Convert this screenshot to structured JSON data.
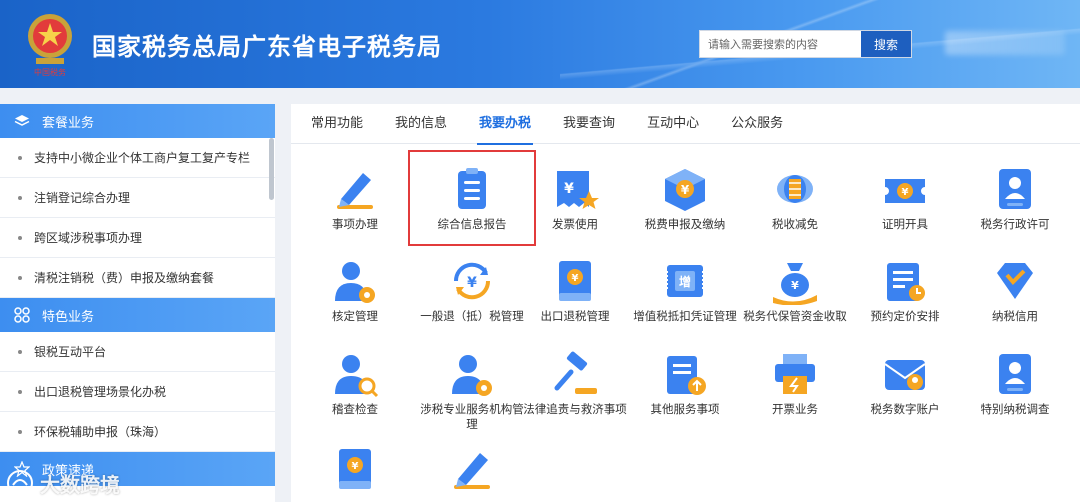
{
  "header": {
    "title": "国家税务总局广东省电子税务局",
    "emblem_text": "中国税务",
    "search": {
      "placeholder": "请输入需要搜索的内容",
      "button": "搜索"
    }
  },
  "sidebar": {
    "sections": [
      {
        "title": "套餐业务",
        "icon": "layers-icon",
        "items": [
          "支持中小微企业个体工商户复工复产专栏",
          "注销登记综合办理",
          "跨区域涉税事项办理",
          "清税注销税（费）申报及缴纳套餐"
        ]
      },
      {
        "title": "特色业务",
        "icon": "grid-icon",
        "items": [
          "银税互动平台",
          "出口退税管理场景化办税",
          "环保税辅助申报（珠海）"
        ]
      },
      {
        "title": "政策速递",
        "icon": "star-icon",
        "items": []
      }
    ]
  },
  "tabs": [
    "常用功能",
    "我的信息",
    "我要办税",
    "我要查询",
    "互动中心",
    "公众服务"
  ],
  "active_tab": "我要办税",
  "services": [
    {
      "label": "事项办理",
      "icon": "pen-icon"
    },
    {
      "label": "综合信息报告",
      "icon": "clipboard-icon"
    },
    {
      "label": "发票使用",
      "icon": "invoice-icon"
    },
    {
      "label": "税费申报及缴纳",
      "icon": "cube-yuan-icon"
    },
    {
      "label": "税收减免",
      "icon": "coins-icon"
    },
    {
      "label": "证明开具",
      "icon": "ticket-icon"
    },
    {
      "label": "税务行政许可",
      "icon": "id-card-icon"
    },
    {
      "label": "核定管理",
      "icon": "user-gear-icon"
    },
    {
      "label": "一般退（抵）税管理",
      "icon": "refund-cycle-icon"
    },
    {
      "label": "出口退税管理",
      "icon": "book-yuan-icon"
    },
    {
      "label": "增值税抵扣凭证管理",
      "icon": "voucher-icon"
    },
    {
      "label": "税务代保管资金收取",
      "icon": "money-bag-icon"
    },
    {
      "label": "预约定价安排",
      "icon": "document-icon"
    },
    {
      "label": "纳税信用",
      "icon": "diamond-check-icon"
    },
    {
      "label": "稽查检查",
      "icon": "user-search-icon"
    },
    {
      "label": "涉税专业服务机构管理",
      "icon": "user-gear-icon"
    },
    {
      "label": "法律追责与救济事项",
      "icon": "gavel-icon"
    },
    {
      "label": "其他服务事项",
      "icon": "list-upload-icon"
    },
    {
      "label": "开票业务",
      "icon": "print-icon"
    },
    {
      "label": "税务数字账户",
      "icon": "mail-user-icon"
    },
    {
      "label": "特别纳税调查",
      "icon": "id-card-icon"
    },
    {
      "label": "",
      "icon": "book-yuan-icon"
    },
    {
      "label": "",
      "icon": "pen-icon"
    }
  ],
  "highlighted_service": "综合信息报告",
  "watermark": "大数跨境",
  "colors": {
    "header": "#1a63c8",
    "accent": "#1f6fe0",
    "icon_blue": "#3b82f0",
    "icon_orange": "#f5a623",
    "highlight": "#e23b3b"
  }
}
